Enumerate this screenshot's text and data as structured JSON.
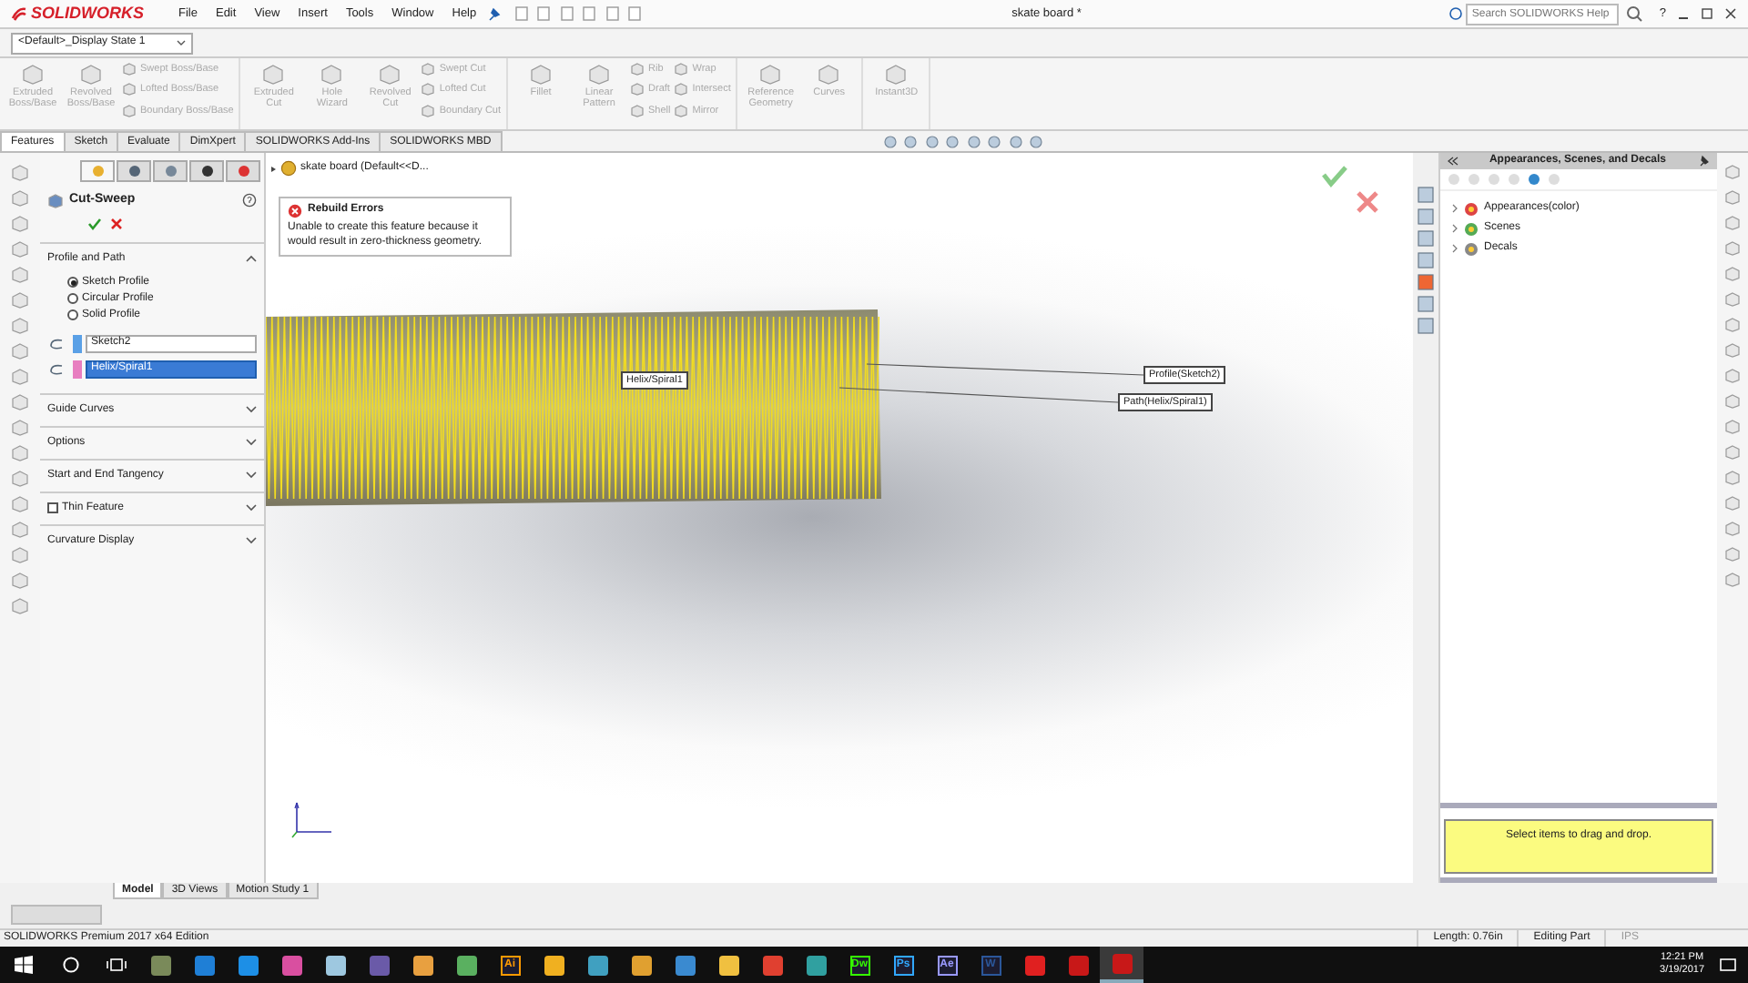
{
  "title_bar": {
    "logo": "SOLIDWORKS",
    "menu": [
      "File",
      "Edit",
      "View",
      "Insert",
      "Tools",
      "Window",
      "Help"
    ],
    "document_title": "skate board *",
    "search": {
      "placeholder": "Search SOLIDWORKS Help"
    },
    "help": "?"
  },
  "display_state": {
    "value": "<Default>_Display State 1"
  },
  "ribbon": {
    "groups": [
      {
        "tools": [
          {
            "kind": "large",
            "label": "Extruded Boss/Base",
            "disabled": true
          },
          {
            "kind": "large",
            "label": "Revolved Boss/Base",
            "disabled": true
          },
          {
            "kind": "stack",
            "items": [
              {
                "label": "Swept Boss/Base",
                "disabled": true
              },
              {
                "label": "Lofted Boss/Base",
                "disabled": true
              },
              {
                "label": "Boundary Boss/Base",
                "disabled": true
              }
            ]
          }
        ]
      },
      {
        "tools": [
          {
            "kind": "large",
            "label": "Extruded Cut",
            "disabled": true
          },
          {
            "kind": "large",
            "label": "Hole Wizard",
            "disabled": true
          },
          {
            "kind": "large",
            "label": "Revolved Cut",
            "disabled": true
          },
          {
            "kind": "stack",
            "items": [
              {
                "label": "Swept Cut",
                "disabled": true
              },
              {
                "label": "Lofted Cut",
                "disabled": true
              },
              {
                "label": "Boundary Cut",
                "disabled": true
              }
            ]
          }
        ]
      },
      {
        "tools": [
          {
            "kind": "large",
            "label": "Fillet",
            "disabled": true
          },
          {
            "kind": "large",
            "label": "Linear Pattern",
            "disabled": true
          },
          {
            "kind": "stack",
            "items": [
              {
                "label": "Rib",
                "disabled": true
              },
              {
                "label": "Draft",
                "disabled": true
              },
              {
                "label": "Shell",
                "disabled": true
              }
            ]
          },
          {
            "kind": "stack",
            "items": [
              {
                "label": "Wrap",
                "disabled": true
              },
              {
                "label": "Intersect",
                "disabled": true
              },
              {
                "label": "Mirror",
                "disabled": true
              }
            ]
          }
        ]
      },
      {
        "tools": [
          {
            "kind": "large",
            "label": "Reference Geometry",
            "disabled": true
          },
          {
            "kind": "large",
            "label": "Curves",
            "disabled": true
          }
        ]
      },
      {
        "tools": [
          {
            "kind": "large",
            "label": "Instant3D",
            "disabled": true
          }
        ]
      }
    ]
  },
  "command_tabs": [
    {
      "label": "Features",
      "selected": true
    },
    {
      "label": "Sketch",
      "selected": false
    },
    {
      "label": "Evaluate",
      "selected": false
    },
    {
      "label": "DimXpert",
      "selected": false
    },
    {
      "label": "SOLIDWORKS Add-Ins",
      "selected": false
    },
    {
      "label": "SOLIDWORKS MBD",
      "selected": false
    }
  ],
  "property_manager": {
    "title": "Cut-Sweep",
    "sections": [
      {
        "kind": "group",
        "title": "Profile and Path",
        "expanded": true,
        "options": [
          {
            "label": "Sketch Profile",
            "selected": true
          },
          {
            "label": "Circular Profile",
            "selected": false
          },
          {
            "label": "Solid Profile",
            "selected": false
          }
        ],
        "selections": [
          {
            "value": "Sketch2",
            "color": "#5aa0e6",
            "selected": false
          },
          {
            "value": "Helix/Spiral1",
            "color": "#e87ec0",
            "selected": true
          }
        ]
      },
      {
        "kind": "group",
        "title": "Guide Curves",
        "expanded": false
      },
      {
        "kind": "group",
        "title": "Options",
        "expanded": false
      },
      {
        "kind": "group",
        "title": "Start and End Tangency",
        "expanded": false
      },
      {
        "kind": "check",
        "title": "Thin Feature",
        "checked": false,
        "expanded": false
      },
      {
        "kind": "group",
        "title": "Curvature Display",
        "expanded": false
      }
    ]
  },
  "viewport": {
    "tree_root": "skate board  (Default<<D...",
    "error": {
      "title": "Rebuild Errors",
      "message": "Unable to create this feature because it would result in zero-thickness geometry."
    },
    "callouts": [
      {
        "label": "Helix/Spiral1"
      },
      {
        "label": "Profile(Sketch2)"
      },
      {
        "label": "Path(Helix/Spiral1)"
      }
    ]
  },
  "task_pane": {
    "title": "Appearances, Scenes, and Decals",
    "tree": [
      {
        "label": "Appearances(color)",
        "expanded": false
      },
      {
        "label": "Scenes",
        "expanded": false
      },
      {
        "label": "Decals",
        "expanded": false
      }
    ],
    "hint": "Select items to drag and drop."
  },
  "bottom_tabs": [
    {
      "label": "Model",
      "selected": true
    },
    {
      "label": "3D Views",
      "selected": false
    },
    {
      "label": "Motion Study 1",
      "selected": false
    }
  ],
  "status_bar": {
    "edition": "SOLIDWORKS Premium 2017 x64 Edition",
    "length": "Length: 0.76in",
    "mode": "Editing Part",
    "units": "IPS"
  },
  "taskbar": {
    "apps": [
      {
        "kind": "tile",
        "color": "#7a8a5a",
        "active": false
      },
      {
        "kind": "tile",
        "color": "#1f7fd6",
        "active": false
      },
      {
        "kind": "tile",
        "color": "#1d8fe6",
        "active": false
      },
      {
        "kind": "tile",
        "color": "#d94fa0",
        "active": false
      },
      {
        "kind": "tile",
        "color": "#9ec8e0",
        "active": false
      },
      {
        "kind": "tile",
        "color": "#6a5aa8",
        "active": false
      },
      {
        "kind": "tile",
        "color": "#e8a040",
        "active": false
      },
      {
        "kind": "tile",
        "color": "#5ab060",
        "active": false
      },
      {
        "kind": "text",
        "label": "Ai",
        "color": "#ff9a00",
        "active": false
      },
      {
        "kind": "tile",
        "color": "#f0b020",
        "active": false
      },
      {
        "kind": "tile",
        "color": "#40a0c0",
        "active": false
      },
      {
        "kind": "tile",
        "color": "#e0a030",
        "active": false
      },
      {
        "kind": "tile",
        "color": "#3a8ad0",
        "active": false
      },
      {
        "kind": "tile",
        "color": "#f0c040",
        "active": false
      },
      {
        "kind": "tile",
        "color": "#e04030",
        "active": false
      },
      {
        "kind": "tile",
        "color": "#30a0a0",
        "active": false
      },
      {
        "kind": "text",
        "label": "Dw",
        "color": "#35fa00",
        "active": false
      },
      {
        "kind": "text",
        "label": "Ps",
        "color": "#31a8ff",
        "active": false
      },
      {
        "kind": "text",
        "label": "Ae",
        "color": "#9999ff",
        "active": false
      },
      {
        "kind": "text",
        "label": "W",
        "color": "#2b579a",
        "active": false
      },
      {
        "kind": "tile",
        "color": "#e02020",
        "active": false
      },
      {
        "kind": "tile",
        "color": "#c81818",
        "active": false
      },
      {
        "kind": "tile",
        "color": "#c81818",
        "active": true
      }
    ],
    "time": "12:21 PM",
    "date": "3/19/2017"
  }
}
